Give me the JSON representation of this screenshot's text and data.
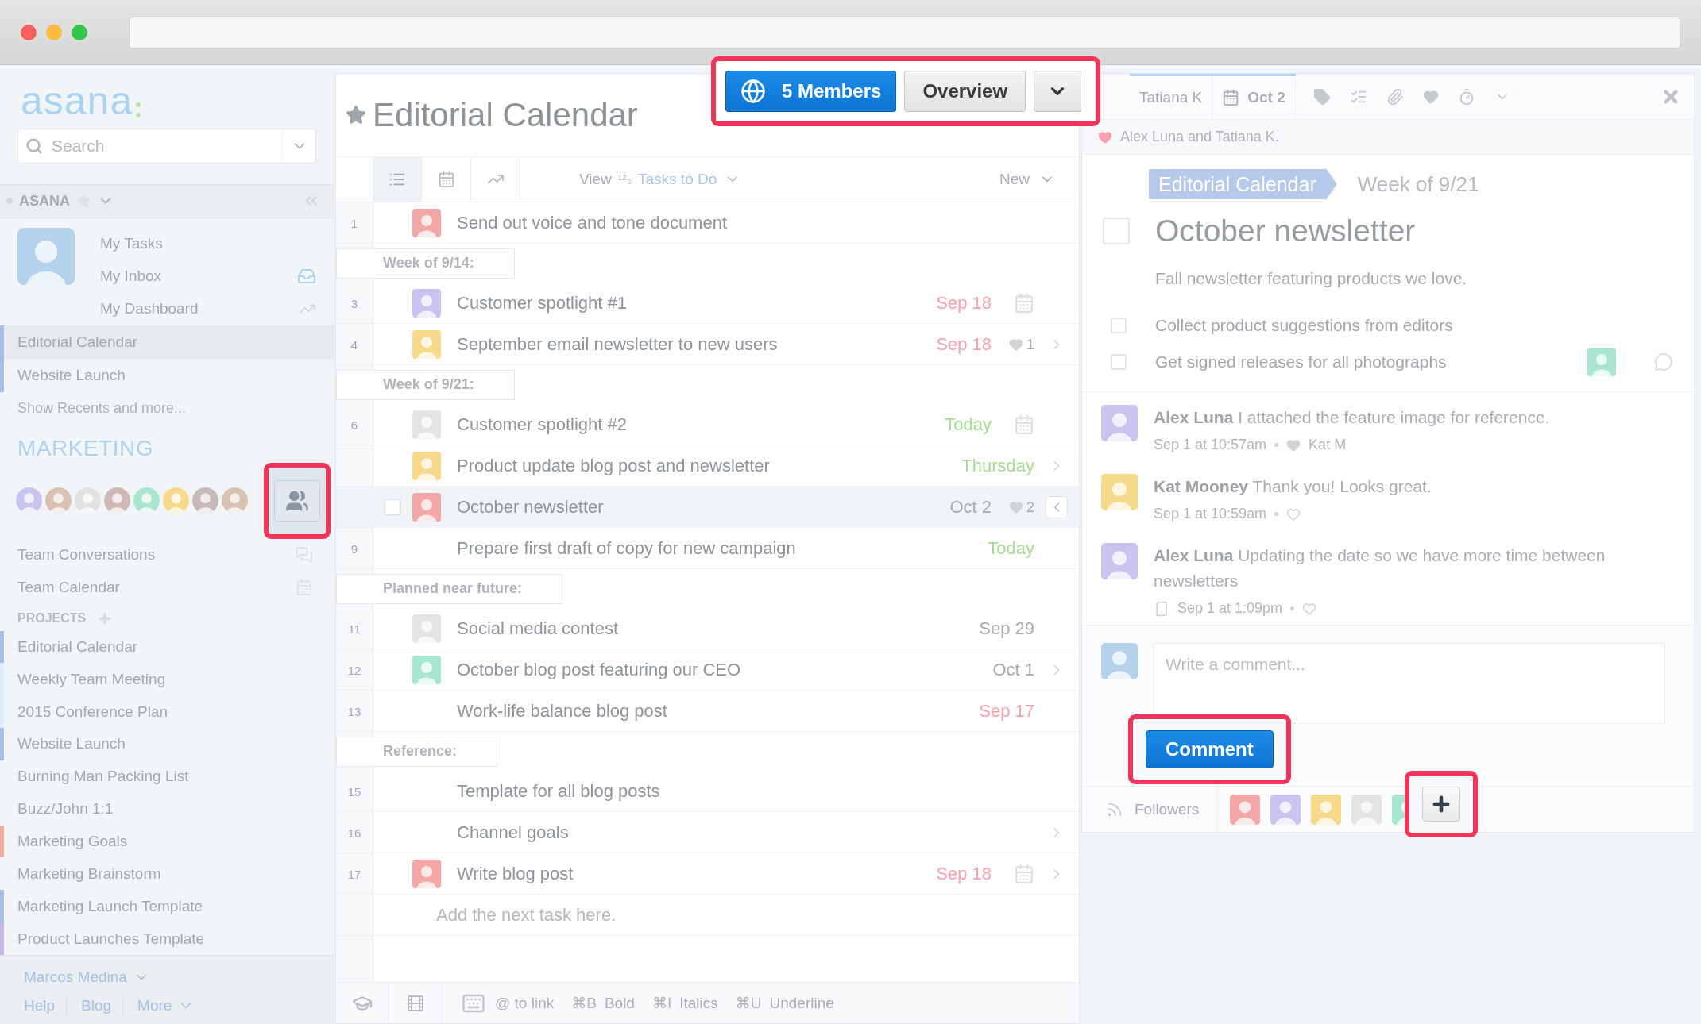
{
  "sidebar": {
    "logo": "asana",
    "search": {
      "placeholder": "Search"
    },
    "workspace": "ASANA",
    "user_links": [
      {
        "label": "My Tasks",
        "kind": "tasks"
      },
      {
        "label": "My Inbox",
        "kind": "inbox"
      },
      {
        "label": "My Dashboard",
        "kind": "dashboard"
      }
    ],
    "recents": [
      {
        "label": "Editorial Calendar",
        "selected": true,
        "color": "#aabde6"
      },
      {
        "label": "Website Launch",
        "selected": false,
        "color": "#aabde6"
      }
    ],
    "show_more": "Show Recents and more...",
    "team": {
      "name": "MARKETING",
      "invite_highlighted": true,
      "members": [
        {
          "color": "#c9c3f0"
        },
        {
          "color": "#d9c2b4"
        },
        {
          "color": "#e2e2e2"
        },
        {
          "color": "#cfb9b4"
        },
        {
          "color": "#a8e6cf"
        },
        {
          "color": "#f6d98a"
        },
        {
          "color": "#c7b9b6"
        },
        {
          "color": "#d8c3b3"
        }
      ]
    },
    "team_links": [
      {
        "label": "Team Conversations",
        "kind": "conversations"
      },
      {
        "label": "Team Calendar",
        "kind": "calendar"
      }
    ],
    "projects_heading": "PROJECTS",
    "projects": [
      {
        "label": "Editorial Calendar",
        "color": "#aabde6"
      },
      {
        "label": "Weekly Team Meeting",
        "color": "#dcecf8"
      },
      {
        "label": "2015 Conference Plan",
        "color": "#dcecf8"
      },
      {
        "label": "Website Launch",
        "color": "#aabde6"
      },
      {
        "label": "Burning Man Packing List"
      },
      {
        "label": "Buzz/John 1:1"
      },
      {
        "label": "Marketing Goals",
        "color": "#eeb0a0"
      },
      {
        "label": "Marketing Brainstorm"
      },
      {
        "label": "Marketing Launch Template",
        "color": "#aabde6"
      },
      {
        "label": "Product Launches Template",
        "color": "#c9b8e6"
      }
    ],
    "user": "Marcos Medina",
    "footer_links": [
      {
        "label": "Help",
        "menu": false
      },
      {
        "label": "Blog",
        "menu": false
      },
      {
        "label": "More",
        "menu": true
      }
    ]
  },
  "project": {
    "title": "Editorial Calendar",
    "starred": true,
    "actions": {
      "highlighted": true,
      "members": "5 Members",
      "overview": "Overview"
    },
    "views": [
      {
        "kind": "list",
        "selected": true
      },
      {
        "kind": "calendar",
        "selected": false
      },
      {
        "kind": "chart",
        "selected": false
      }
    ],
    "view_label": "View",
    "sort_mark": "¹²₃",
    "filter": "Tasks to Do",
    "new": "New",
    "rows": [
      {
        "kind": "task",
        "number": "1",
        "title": "Send out voice and tone document",
        "avatar": {
          "color": "#f3a7a7"
        },
        "selected": false
      },
      {
        "kind": "section",
        "title": "Week of 9/14:"
      },
      {
        "kind": "task",
        "number": "3",
        "title": "Customer spotlight #1",
        "avatar": {
          "color": "#c9c3f0"
        },
        "due": {
          "text": "Sep 18",
          "color": "#f7a1b1"
        },
        "calendar": true,
        "selected": false
      },
      {
        "kind": "task",
        "number": "4",
        "title": "September email newsletter to new users",
        "avatar": {
          "color": "#f6d98a"
        },
        "due": {
          "text": "Sep 18",
          "color": "#f7a1b1"
        },
        "hearts": "1",
        "chevron": true,
        "selected": false
      },
      {
        "kind": "section",
        "title": "Week of 9/21:"
      },
      {
        "kind": "task",
        "number": "6",
        "title": "Customer spotlight #2",
        "avatar": {
          "color": "#e4e4e4"
        },
        "due": {
          "text": "Today",
          "color": "#a6dc93"
        },
        "calendar": true,
        "selected": false
      },
      {
        "kind": "task",
        "title": "Product update blog post and newsletter",
        "avatar": {
          "color": "#f6d98a"
        },
        "due": {
          "text": "Thursday",
          "color": "#a6dc93"
        },
        "chevron": true,
        "selected": false
      },
      {
        "kind": "task",
        "title": "October newsletter",
        "avatar": {
          "color": "#f3a7a7"
        },
        "due": {
          "text": "Oct 2",
          "color": "#a7abb0"
        },
        "hearts": "2",
        "chevron": true,
        "selected": true
      },
      {
        "kind": "task",
        "number": "9",
        "title": "Prepare first draft of copy for new campaign",
        "due": {
          "text": "Today",
          "color": "#a6dc93"
        },
        "selected": false
      },
      {
        "kind": "section",
        "title": "Planned near future:"
      },
      {
        "kind": "task",
        "number": "11",
        "title": "Social media contest",
        "avatar": {
          "color": "#e4e4e4"
        },
        "due": {
          "text": "Sep 29",
          "color": "#a7abb0"
        },
        "selected": false
      },
      {
        "kind": "task",
        "number": "12",
        "title": "October blog post featuring our CEO",
        "avatar": {
          "color": "#a8e6cf"
        },
        "due": {
          "text": "Oct 1",
          "color": "#a7abb0"
        },
        "chevron": true,
        "selected": false
      },
      {
        "kind": "task",
        "number": "13",
        "title": "Work-life balance blog post",
        "due": {
          "text": "Sep 17",
          "color": "#f7a1b1"
        },
        "selected": false
      },
      {
        "kind": "section",
        "title": "Reference:"
      },
      {
        "kind": "task",
        "number": "15",
        "title": "Template for all blog posts",
        "selected": false
      },
      {
        "kind": "task",
        "number": "16",
        "title": "Channel goals",
        "chevron": true,
        "selected": false
      },
      {
        "kind": "task",
        "number": "17",
        "title": "Write blog post",
        "avatar": {
          "color": "#f3a7a7"
        },
        "due": {
          "text": "Sep 18",
          "color": "#f7a1b1"
        },
        "calendar": true,
        "chevron": true,
        "selected": false
      }
    ],
    "add_task": {
      "placeholder": "Add the next task here."
    },
    "footer": {
      "link_hint": "@ to link",
      "shortcuts": [
        {
          "key": "⌘B",
          "label": "Bold"
        },
        {
          "key": "⌘I",
          "label": "Italics"
        },
        {
          "key": "⌘U",
          "label": "Underline"
        }
      ]
    }
  },
  "task": {
    "assignee": "Tatiana K",
    "due": "Oct 2",
    "hearted_by": "Alex Luna and Tatiana K.",
    "breadcrumb": {
      "project": "Editorial Calendar",
      "section": "Week of 9/21"
    },
    "title": "October newsletter",
    "completed": false,
    "description": "Fall newsletter featuring products we love.",
    "subtasks": [
      {
        "title": "Collect product suggestions from editors",
        "checked": false
      },
      {
        "title": "Get signed releases for all photographs",
        "checked": false,
        "assignee": {
          "color": "#a8e6cf"
        }
      }
    ],
    "comments": [
      {
        "author": "Alex Luna",
        "text": "I attached the feature image for reference.",
        "avatar": {
          "color": "#c9c3f0"
        },
        "time": "Sep 1 at 10:57am",
        "liked": true,
        "liker": "Kat M",
        "mobile": false
      },
      {
        "author": "Kat Mooney",
        "text": "Thank you! Looks great.",
        "avatar": {
          "color": "#f6d98a"
        },
        "time": "Sep 1 at 10:59am",
        "liked": false,
        "mobile": false
      },
      {
        "author": "Alex Luna",
        "text": "Updating the date so we have more time between newsletters",
        "avatar": {
          "color": "#c9c3f0"
        },
        "time": "Sep 1 at 1:09pm",
        "liked": false,
        "mobile": true
      }
    ],
    "comment_box": {
      "placeholder": "Write a comment...",
      "button": "Comment",
      "highlighted": true
    },
    "followers": {
      "label": "Followers",
      "add_highlighted": true,
      "avatars": [
        {
          "color": "#f3a7a7"
        },
        {
          "color": "#c9c3f0"
        },
        {
          "color": "#f6d98a"
        },
        {
          "color": "#e4e4e4"
        },
        {
          "color": "#a8e6cf"
        }
      ]
    }
  }
}
